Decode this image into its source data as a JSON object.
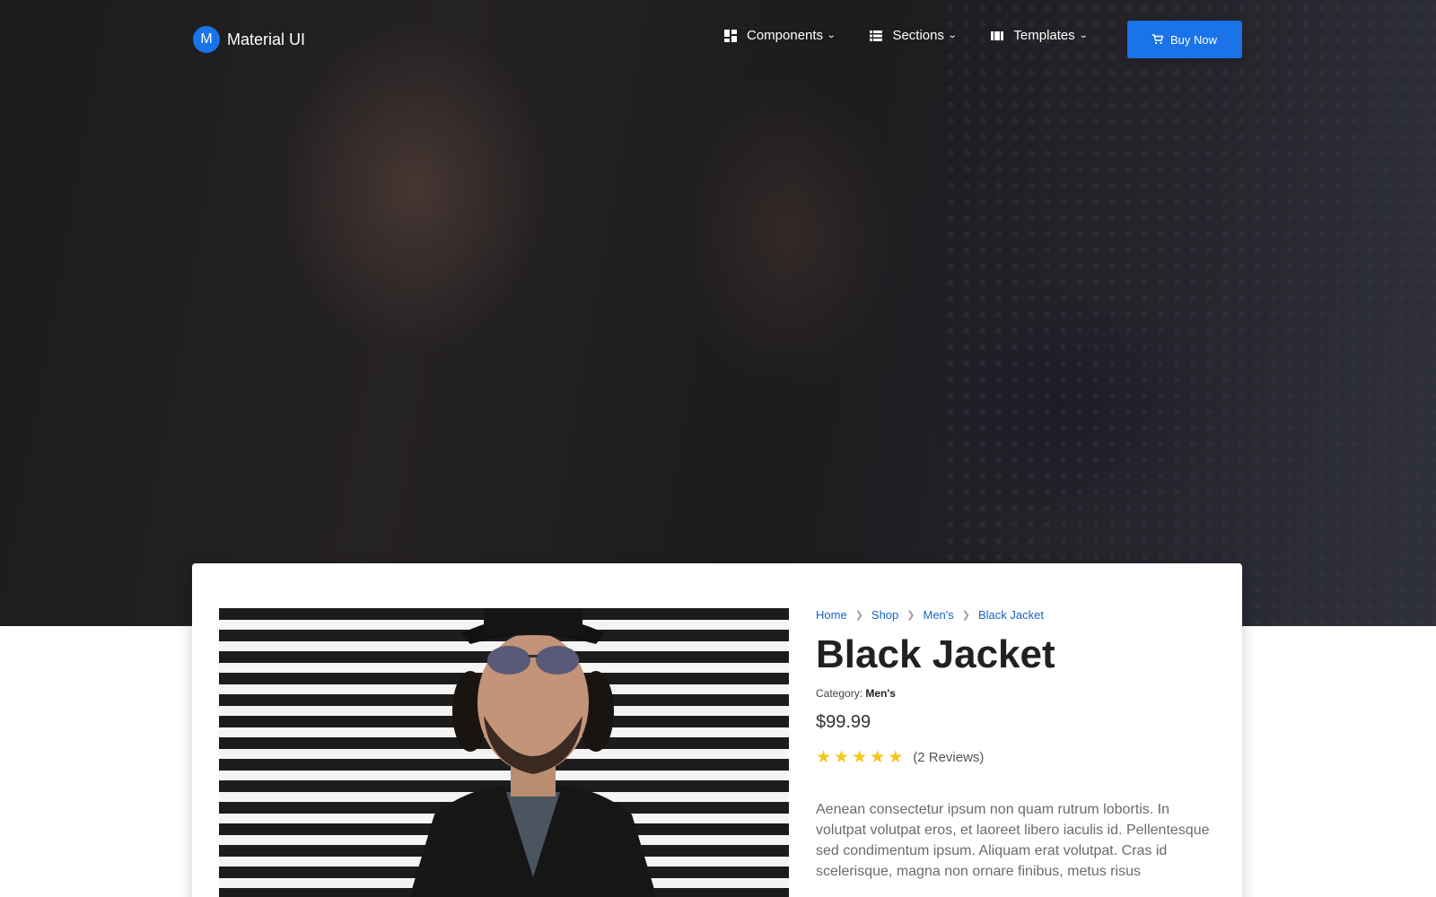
{
  "navbar": {
    "brand_letter": "M",
    "brand_name": "Material UI",
    "links": [
      {
        "label": "Components",
        "icon": "dashboard-icon"
      },
      {
        "label": "Sections",
        "icon": "list-icon"
      },
      {
        "label": "Templates",
        "icon": "view-columns-icon"
      }
    ],
    "buy_label": "Buy Now",
    "buy_icon": "cart-icon"
  },
  "colors": {
    "primary": "#1a73e8",
    "star": "#f5c518",
    "link": "#1565c0"
  },
  "product": {
    "breadcrumb": [
      "Home",
      "Shop",
      "Men's",
      "Black Jacket"
    ],
    "title": "Black Jacket",
    "category_label": "Category:",
    "category_value": "Men's",
    "price": "$99.99",
    "rating_stars": 5,
    "reviews": "(2 Reviews)",
    "description": "Aenean consectetur ipsum non quam rutrum lobortis. In volutpat volutpat eros, et laoreet libero iaculis id. Pellentesque sed condimentum ipsum. Aliquam erat volutpat. Cras id scelerisque, magna non ornare finibus, metus risus"
  }
}
